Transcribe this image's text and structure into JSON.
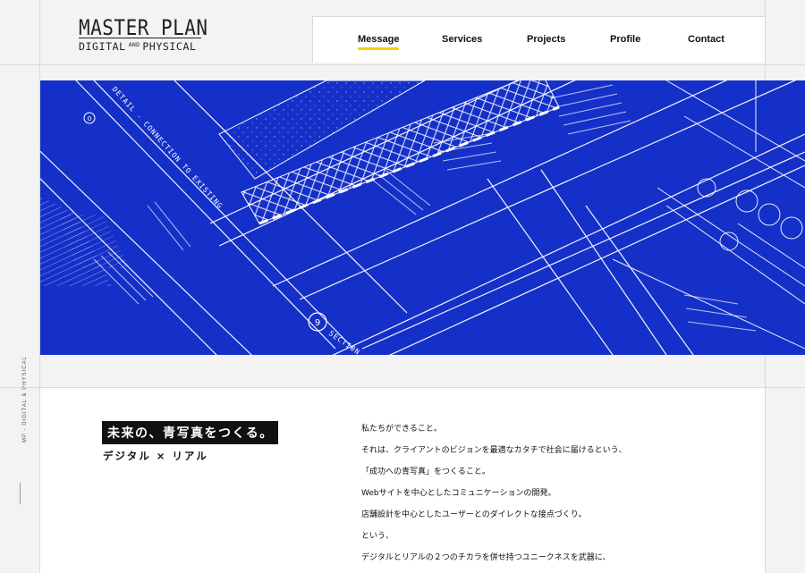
{
  "header": {
    "logo_line1": "MASTER PLAN",
    "logo_line2_left": "DIGITAL",
    "logo_line2_small": "AND",
    "logo_line2_right": "PHYSICAL",
    "nav": [
      {
        "label": "Message",
        "active": true
      },
      {
        "label": "Services",
        "active": false
      },
      {
        "label": "Projects",
        "active": false
      },
      {
        "label": "Profile",
        "active": false
      },
      {
        "label": "Contact",
        "active": false
      }
    ]
  },
  "hero": {
    "background": "#1530c8",
    "labels": {
      "detail": "DETAIL - CONNECTION TO EXISTING",
      "section": "SECTION",
      "grid_bubble": "9",
      "small_bubble": "0"
    }
  },
  "side": {
    "vertical_text": "MP - DIGITAL & PHYSICAL"
  },
  "content": {
    "tagline": "未来の、青写真をつくる。",
    "subtitle": "デジタル × リアル",
    "paragraphs": [
      "私たちができること。",
      "それは、クライアントのビジョンを最適なカタチで社会に届けるという、",
      "「成功への青写真」をつくること。",
      "Webサイトを中心としたコミュニケーションの開発。",
      "店舗設計を中心としたユーザーとのダイレクトな接点づくり。",
      "という、",
      "デジタルとリアルの２つのチカラを併せ持つユニークネスを武器に、"
    ]
  },
  "colors": {
    "accent_underline": "#f5d400",
    "blueprint": "#1530c8",
    "line": "#ffffff"
  }
}
